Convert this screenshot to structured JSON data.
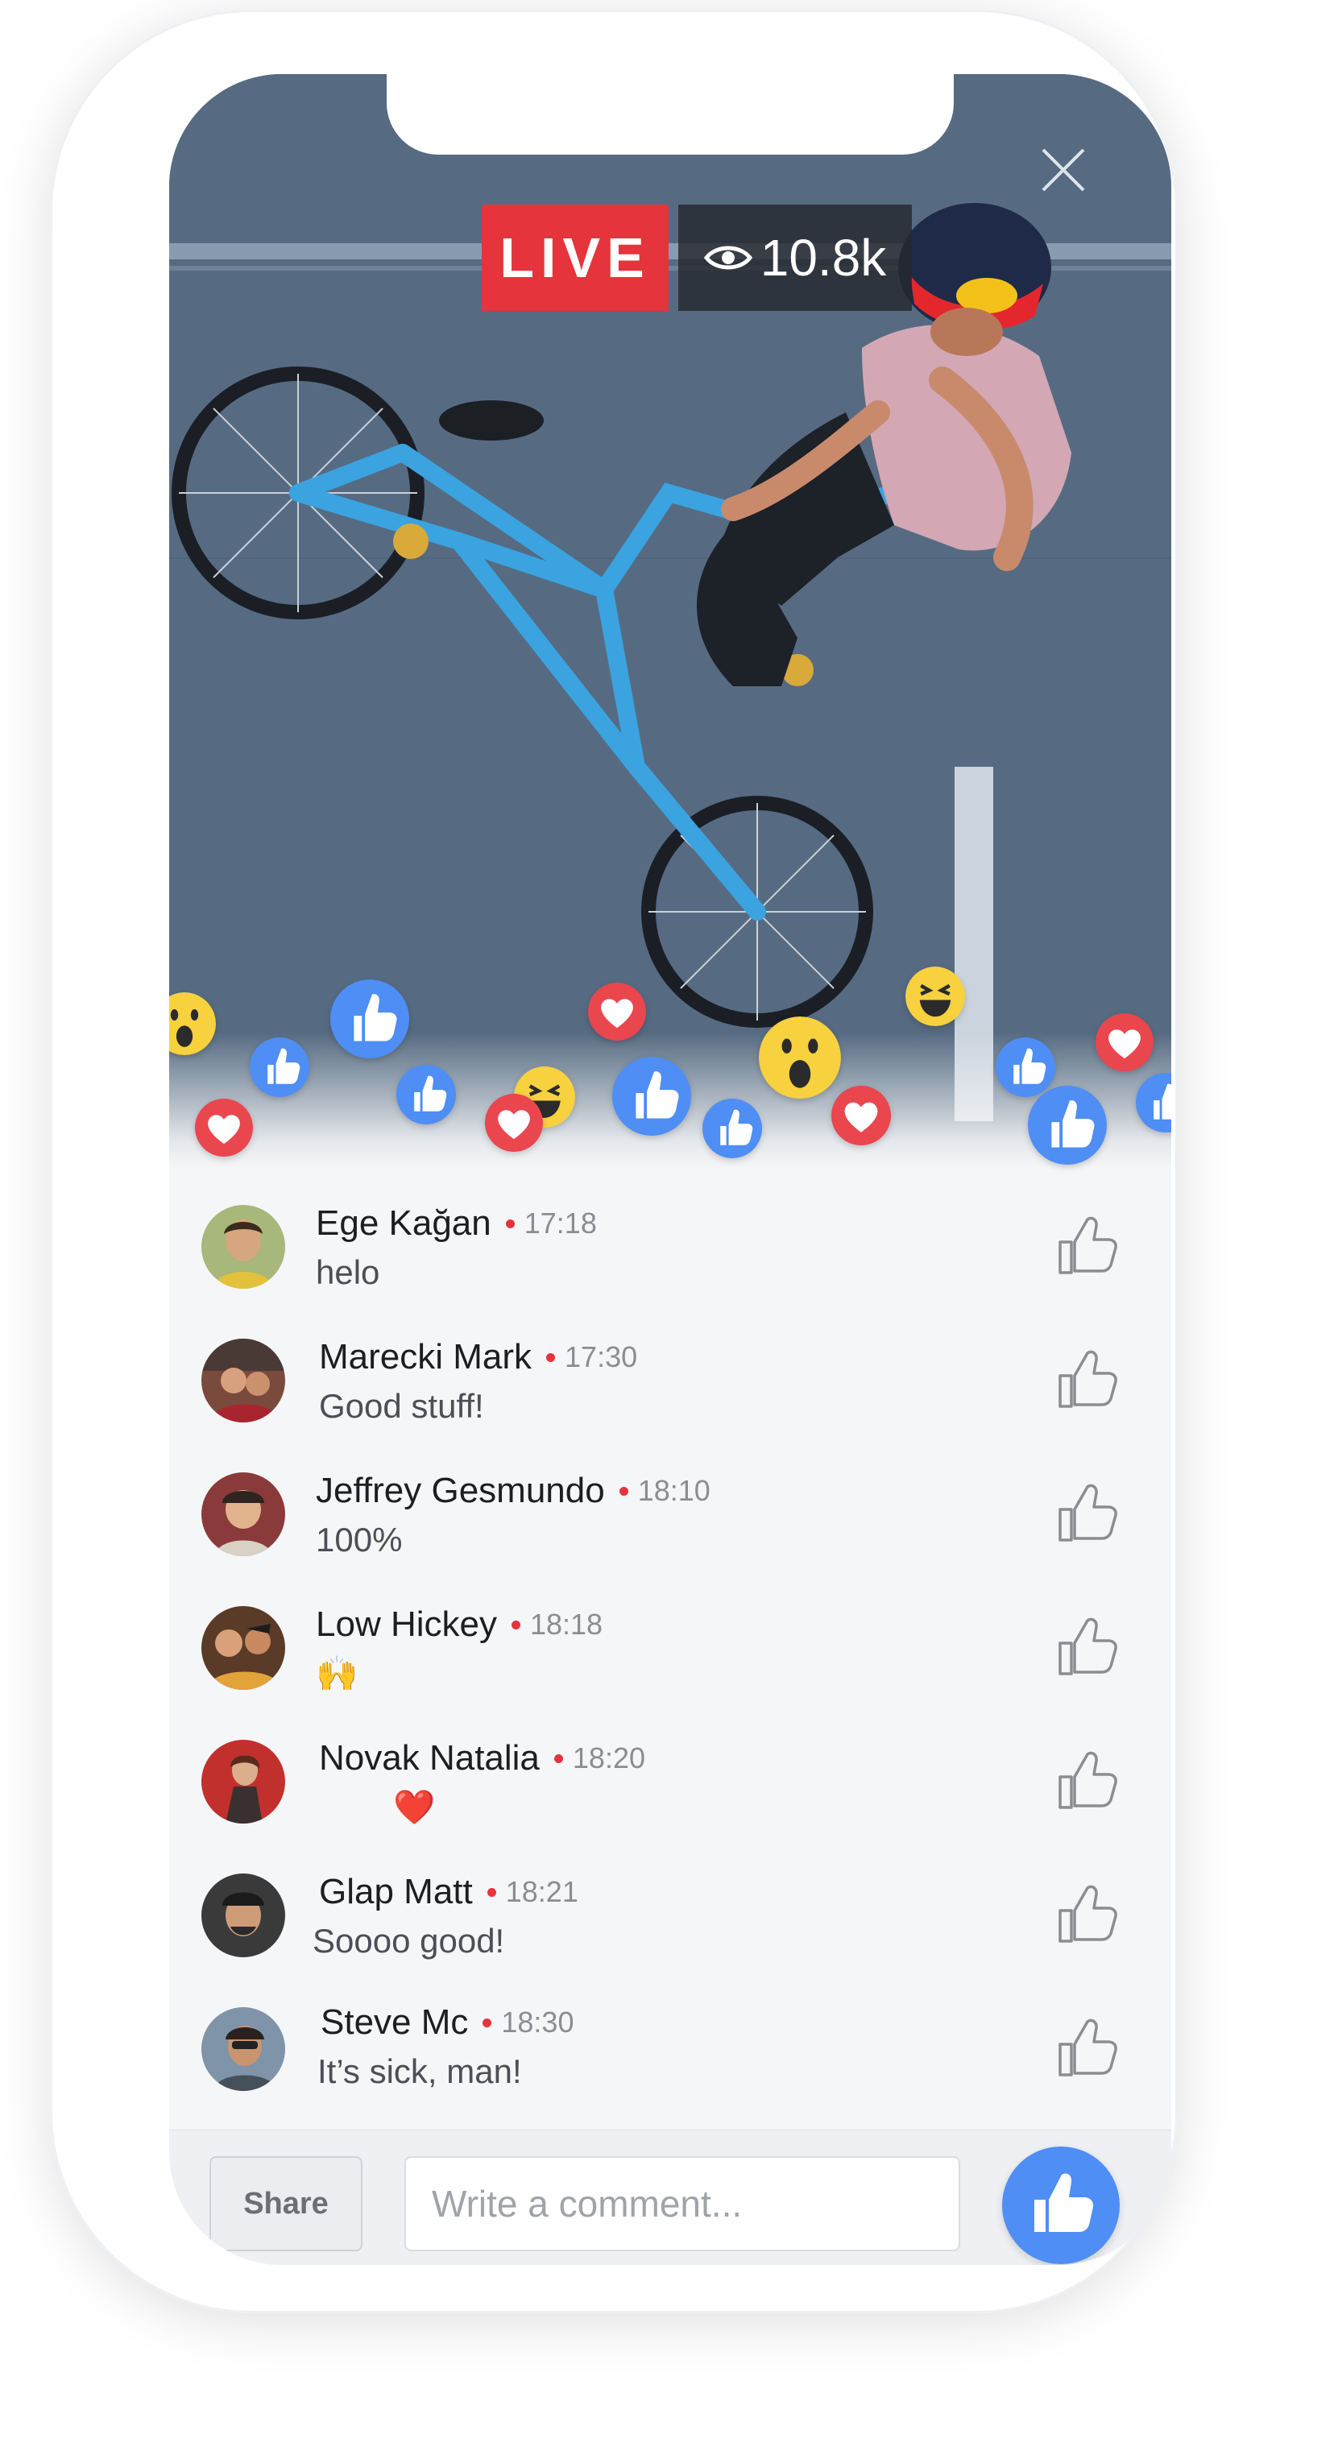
{
  "stream": {
    "live_label": "LIVE",
    "viewers": "10.8k",
    "view_icon": "eye-icon",
    "close_icon": "close-icon"
  },
  "reactions": [
    {
      "type": "wow"
    },
    {
      "type": "like"
    },
    {
      "type": "like"
    },
    {
      "type": "love"
    },
    {
      "type": "like"
    },
    {
      "type": "haha"
    },
    {
      "type": "love"
    },
    {
      "type": "love"
    },
    {
      "type": "like"
    },
    {
      "type": "like"
    },
    {
      "type": "wow"
    },
    {
      "type": "love"
    },
    {
      "type": "haha"
    },
    {
      "type": "like"
    },
    {
      "type": "love"
    },
    {
      "type": "like"
    },
    {
      "type": "like"
    }
  ],
  "comments": [
    {
      "name": "Ege Kağan",
      "time": "17:18",
      "text": "helo"
    },
    {
      "name": "Marecki Mark",
      "time": "17:30",
      "text": "Good stuff!"
    },
    {
      "name": "Jeffrey Gesmundo",
      "time": "18:10",
      "text": "100%"
    },
    {
      "name": "Low Hickey",
      "time": "18:18",
      "text": "🙌"
    },
    {
      "name": "Novak Natalia",
      "time": "18:20",
      "text": "❤️"
    },
    {
      "name": "Glap Matt",
      "time": "18:21",
      "text": "Soooo good!"
    },
    {
      "name": "Steve Mc",
      "time": "18:30",
      "text": "It’s sick, man!"
    }
  ],
  "composer": {
    "share_label": "Share",
    "comment_placeholder": "Write a comment...",
    "comment_value": "",
    "like_icon": "thumbs-up-icon"
  },
  "colors": {
    "live_red": "#e5343c",
    "facebook_blue": "#4e8ef5",
    "love_red": "#e9464e"
  }
}
